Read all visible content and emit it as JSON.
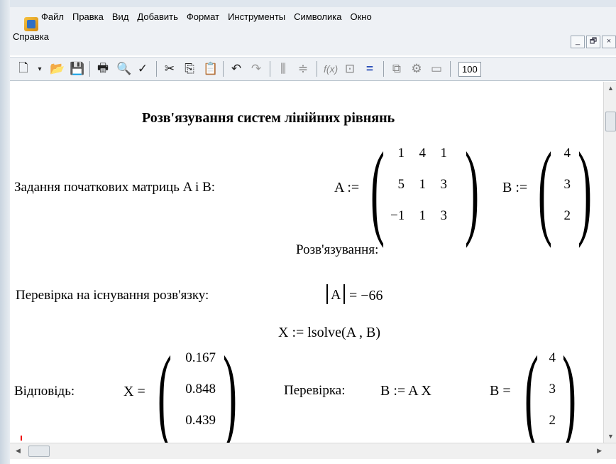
{
  "menu": {
    "items": [
      "Файл",
      "Правка",
      "Вид",
      "Добавить",
      "Формат",
      "Инструменты",
      "Символика",
      "Окно"
    ],
    "second_row": "Справка"
  },
  "window_buttons": {
    "minimize": "_",
    "restore": "🗗",
    "close": "×"
  },
  "toolbar": {
    "zoom_value": "100"
  },
  "document": {
    "title": "Розв'язування систем лінійних рівнянь",
    "init_label": "Задання початкових матриць A i B:",
    "A_assign": "A :=",
    "B_assign": "B :=",
    "A": [
      [
        "1",
        "4",
        "1"
      ],
      [
        "5",
        "1",
        "3"
      ],
      [
        "−1",
        "1",
        "3"
      ]
    ],
    "B": [
      "4",
      "3",
      "2"
    ],
    "solving_label": "Розв'язування:",
    "check_label": "Перевірка на існування розв'язку:",
    "det_expr": "A",
    "det_result": "= −66",
    "lsolve_expr": "X := lsolve(A , B)",
    "answer_label": "Відповідь:",
    "X_equals": "X =",
    "X": [
      "0.167",
      "0.848",
      "0.439"
    ],
    "verify_label": "Перевірка:",
    "verify_expr": "B := A X",
    "B_equals": "B =",
    "B_result": [
      "4",
      "3",
      "2"
    ]
  }
}
